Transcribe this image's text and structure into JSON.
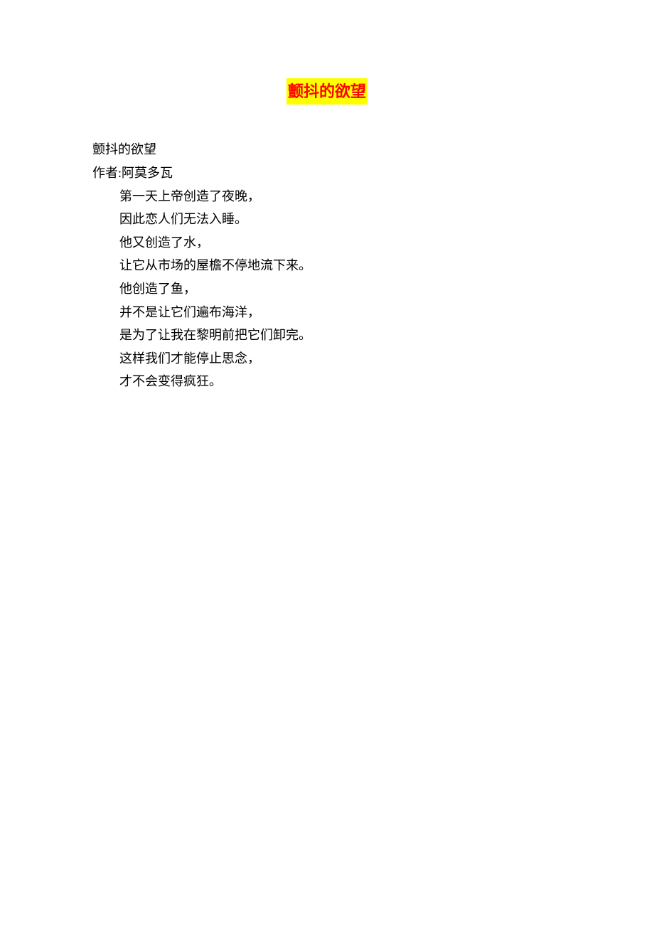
{
  "document": {
    "title": "颤抖的欲望",
    "subtitle": "颤抖的欲望",
    "author_line": "作者:阿莫多瓦",
    "poem_lines": [
      "第一天上帝创造了夜晚，",
      "因此恋人们无法入睡。",
      "他又创造了水，",
      "让它从市场的屋檐不停地流下来。",
      "他创造了鱼，",
      "并不是让它们遍布海洋，",
      "是为了让我在黎明前把它们卸完。",
      "这样我们才能停止思念，",
      "才不会变得疯狂。"
    ]
  }
}
